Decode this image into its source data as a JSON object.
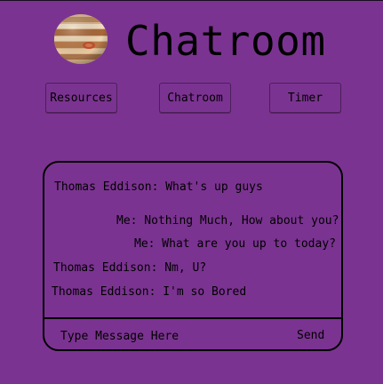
{
  "header": {
    "title": "Chatroom",
    "logo_icon": "jupiter-planet-icon"
  },
  "nav": {
    "resources_label": "Resources",
    "chatroom_label": "Chatroom",
    "timer_label": "Timer"
  },
  "chat": {
    "messages": [
      {
        "sender": "Thomas Eddison",
        "text": "Thomas Eddison: What's up guys",
        "align": "left"
      },
      {
        "sender": "Me",
        "text": "Me: Nothing Much, How about you?",
        "align": "right"
      },
      {
        "sender": "Me",
        "text": "Me: What are you up to today?",
        "align": "right"
      },
      {
        "sender": "Thomas Eddison",
        "text": "Thomas Eddison: Nm, U?",
        "align": "left"
      },
      {
        "sender": "Thomas Eddison",
        "text": "Thomas Eddison: I'm so Bored",
        "align": "left"
      }
    ],
    "input_placeholder": "Type Message Here",
    "send_label": "Send"
  },
  "colors": {
    "background": "#7b3391",
    "text": "#000000",
    "border": "#000000"
  }
}
